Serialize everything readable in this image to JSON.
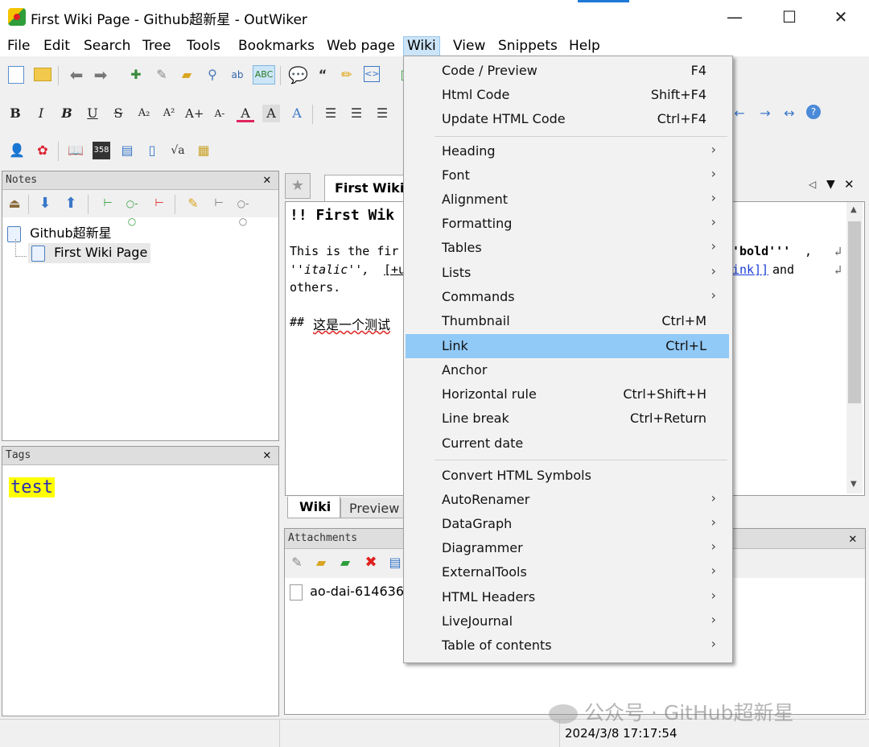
{
  "window": {
    "title": "First Wiki Page - Github超新星 - OutWiker",
    "minimize": "—",
    "maximize": "☐",
    "close": "✕"
  },
  "menubar": [
    "File",
    "Edit",
    "Search",
    "Tree",
    "Tools",
    "Bookmarks",
    "Web page",
    "Wiki",
    "View",
    "Snippets",
    "Help"
  ],
  "notes_panel": {
    "title": "Notes",
    "tree": [
      {
        "label": "Github超新星",
        "level": 0
      },
      {
        "label": "First Wiki Page",
        "level": 1,
        "selected": true
      }
    ]
  },
  "tags_panel": {
    "title": "Tags",
    "tags": [
      "test"
    ]
  },
  "editor": {
    "tab_title": "First Wiki",
    "line1": "!! First Wik",
    "line2_pre": "This is the fir",
    "line2_post": "'bold'''",
    "line2_end": ",",
    "line3_pre": "''italic'', ",
    "line3_link": "[+u",
    "line3_link2": "ink]]",
    "line3_post": " and",
    "line4": "others.",
    "line5_hash": "## ",
    "line5_text": "这是一个测试",
    "bottom_tabs": [
      "Wiki",
      "Preview"
    ]
  },
  "attachments_panel": {
    "title": "Attachments",
    "files": [
      "ao-dai-614636"
    ]
  },
  "wiki_menu": {
    "group1": [
      {
        "label": "Code / Preview",
        "shortcut": "F4"
      },
      {
        "label": "Html Code",
        "shortcut": "Shift+F4"
      },
      {
        "label": "Update HTML Code",
        "shortcut": "Ctrl+F4"
      }
    ],
    "group2": [
      {
        "label": "Heading",
        "submenu": true
      },
      {
        "label": "Font",
        "submenu": true
      },
      {
        "label": "Alignment",
        "submenu": true
      },
      {
        "label": "Formatting",
        "submenu": true
      },
      {
        "label": "Tables",
        "submenu": true
      },
      {
        "label": "Lists",
        "submenu": true
      },
      {
        "label": "Commands",
        "submenu": true
      },
      {
        "label": "Thumbnail",
        "shortcut": "Ctrl+M"
      },
      {
        "label": "Link",
        "shortcut": "Ctrl+L",
        "highlighted": true
      },
      {
        "label": "Anchor"
      },
      {
        "label": "Horizontal rule",
        "shortcut": "Ctrl+Shift+H"
      },
      {
        "label": "Line break",
        "shortcut": "Ctrl+Return"
      },
      {
        "label": "Current date"
      }
    ],
    "group3": [
      {
        "label": "Convert HTML Symbols"
      },
      {
        "label": "AutoRenamer",
        "submenu": true
      },
      {
        "label": "DataGraph",
        "submenu": true
      },
      {
        "label": "Diagrammer",
        "submenu": true
      },
      {
        "label": "ExternalTools",
        "submenu": true
      },
      {
        "label": "HTML Headers",
        "submenu": true
      },
      {
        "label": "LiveJournal",
        "submenu": true
      },
      {
        "label": "Table of contents",
        "submenu": true
      }
    ]
  },
  "status": {
    "datetime": "2024/3/8 17:17:54"
  },
  "watermark": "公众号 · GitHub超新星"
}
